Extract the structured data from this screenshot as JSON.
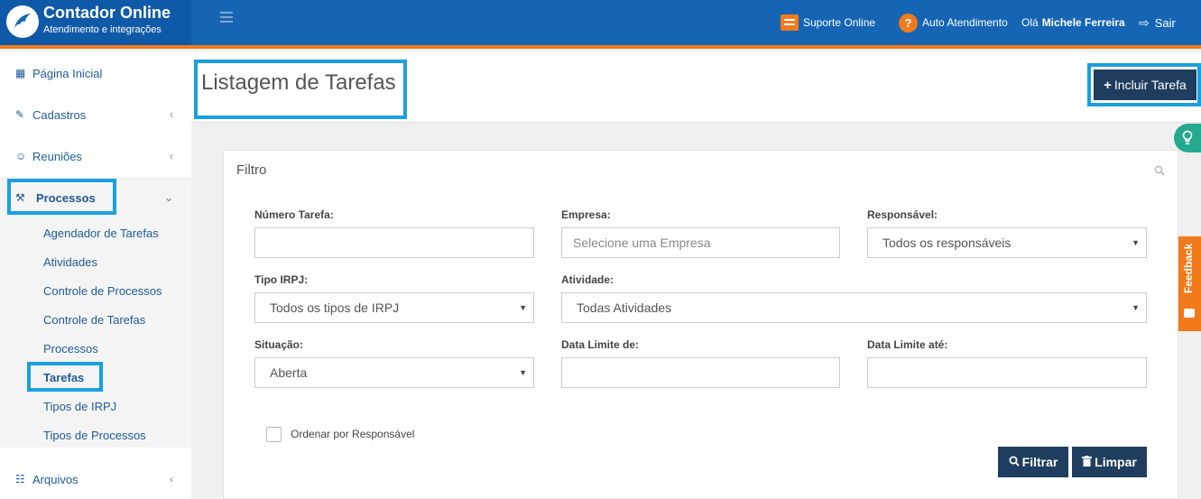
{
  "header": {
    "brand_title": "Contador Online",
    "brand_subtitle": "Atendimento e integrações",
    "suporte_label": "Suporte Online",
    "auto_label": "Auto Atendimento",
    "auto_icon_glyph": "?",
    "greeting_prefix": "Olá",
    "user_name": "Michele Ferreira",
    "logout_label": "Sair",
    "colors": {
      "bar": "#1565b4",
      "accent": "#f27a1a"
    }
  },
  "sidebar": {
    "items": [
      {
        "label": "Página Inicial",
        "icon": "dashboard-icon"
      },
      {
        "label": "Cadastros",
        "icon": "edit-icon"
      },
      {
        "label": "Reuniões",
        "icon": "users-icon"
      },
      {
        "label": "Processos",
        "icon": "gavel-icon"
      },
      {
        "label": "Arquivos",
        "icon": "file-icon"
      }
    ],
    "processos_subitems": [
      "Agendador de Tarefas",
      "Atividades",
      "Controle de Processos",
      "Controle de Tarefas",
      "Processos",
      "Tarefas",
      "Tipos de IRPJ",
      "Tipos de Processos"
    ]
  },
  "page": {
    "title": "Listagem de Tarefas",
    "add_button": "Incluir Tarefa"
  },
  "feedback_label": "Feedback",
  "filter": {
    "title": "Filtro",
    "fields": {
      "numero_tarefa": {
        "label": "Número Tarefa:",
        "value": ""
      },
      "empresa": {
        "label": "Empresa:",
        "placeholder": "Selecione uma Empresa"
      },
      "responsavel": {
        "label": "Responsável:",
        "value": "Todos os responsáveis"
      },
      "tipo_irpj": {
        "label": "Tipo IRPJ:",
        "value": "Todos os tipos de IRPJ"
      },
      "atividade": {
        "label": "Atividade:",
        "value": "Todas Atividades"
      },
      "situacao": {
        "label": "Situação:",
        "value": "Aberta"
      },
      "data_limite_de": {
        "label": "Data Limite de:",
        "value": ""
      },
      "data_limite_ate": {
        "label": "Data Limite até:",
        "value": ""
      }
    },
    "order_by_responsible_label": "Ordenar por Responsável",
    "order_by_responsible_checked": false,
    "filter_button": "Filtrar",
    "clear_button": "Limpar"
  }
}
